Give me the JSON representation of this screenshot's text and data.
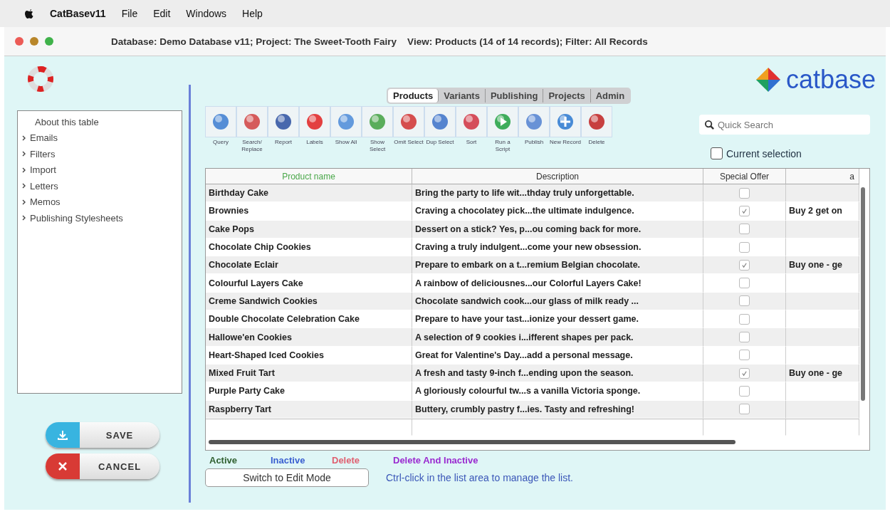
{
  "menu_bar": {
    "app_name": "CatBasev11",
    "items": [
      "File",
      "Edit",
      "Windows",
      "Help"
    ]
  },
  "window": {
    "title": "Database: Demo Database v11; Project: The Sweet-Tooth Fairy    View: Products (14 of 14 records); Filter: All Records"
  },
  "logo": {
    "text": "catbase"
  },
  "sidebar": {
    "items": [
      {
        "label": "About this table",
        "expandable": false
      },
      {
        "label": "Emails",
        "expandable": true
      },
      {
        "label": "Filters",
        "expandable": true
      },
      {
        "label": "Import",
        "expandable": true
      },
      {
        "label": "Letters",
        "expandable": true
      },
      {
        "label": "Memos",
        "expandable": true
      },
      {
        "label": "Publishing Stylesheets",
        "expandable": true
      }
    ]
  },
  "actions": [
    {
      "kind": "save",
      "label": "SAVE"
    },
    {
      "kind": "cancel",
      "label": "CANCEL"
    }
  ],
  "tabs": [
    {
      "label": "Products",
      "selected": true
    },
    {
      "label": "Variants",
      "selected": false
    },
    {
      "label": "Publishing",
      "selected": false
    },
    {
      "label": "Projects",
      "selected": false
    },
    {
      "label": "Admin",
      "selected": false
    }
  ],
  "toolbar": [
    {
      "kind": "query",
      "label": "Query"
    },
    {
      "kind": "search",
      "label": "Search/ Replace"
    },
    {
      "kind": "report",
      "label": "Report"
    },
    {
      "kind": "labels",
      "label": "Labels"
    },
    {
      "kind": "showall",
      "label": "Show All"
    },
    {
      "kind": "showselect",
      "label": "Show Select"
    },
    {
      "kind": "omit",
      "label": "Omit Select"
    },
    {
      "kind": "dup",
      "label": "Dup Select"
    },
    {
      "kind": "sort",
      "label": "Sort"
    },
    {
      "kind": "script",
      "label": "Run a Script"
    },
    {
      "kind": "publish",
      "label": "Publish"
    },
    {
      "kind": "new",
      "label": "New Record"
    },
    {
      "kind": "delete",
      "label": "Delete"
    }
  ],
  "quick_search": {
    "placeholder": "Quick Search"
  },
  "current_selection": {
    "label": "Current selection",
    "checked": false
  },
  "table": {
    "columns": [
      "Product name",
      "Description",
      "Special Offer",
      "a"
    ],
    "rows": [
      {
        "name": "Birthday Cake",
        "description": "Bring the party to life wit...thday truly unforgettable.",
        "special_offer": false
      },
      {
        "name": "Brownies",
        "description": "Craving a chocolatey pick...the ultimate indulgence.",
        "special_offer": true,
        "column_4": "Buy 2 get on"
      },
      {
        "name": "Cake Pops",
        "description": "Dessert on a stick? Yes, p...ou coming back for more.",
        "special_offer": false
      },
      {
        "name": "Chocolate Chip Cookies",
        "description": "Craving a truly indulgent...come your new obsession.",
        "special_offer": false
      },
      {
        "name": "Chocolate Eclair",
        "description": "Prepare to embark on a t...remium Belgian chocolate.",
        "special_offer": true,
        "column_4": "Buy one - ge"
      },
      {
        "name": "Colourful Layers Cake",
        "description": "A rainbow of deliciousnes...our Colorful Layers Cake!",
        "special_offer": false
      },
      {
        "name": "Creme Sandwich Cookies",
        "description": "Chocolate sandwich cook...our glass of milk ready ...",
        "special_offer": false
      },
      {
        "name": "Double Chocolate Celebration Cake",
        "description": "Prepare to have your tast...ionize your dessert game.",
        "special_offer": false
      },
      {
        "name": "Hallowe'en Cookies",
        "description": "A selection of 9 cookies i...ifferent shapes per pack.",
        "special_offer": false
      },
      {
        "name": "Heart-Shaped Iced Cookies",
        "description": "Great for Valentine's Day...add a personal message.",
        "special_offer": false
      },
      {
        "name": "Mixed Fruit Tart",
        "description": "A fresh and tasty 9-inch f...ending upon the season.",
        "special_offer": true,
        "column_4": "Buy one - ge"
      },
      {
        "name": "Purple Party Cake",
        "description": "A gloriously colourful tw...s a vanilla Victoria sponge.",
        "special_offer": false
      },
      {
        "name": "Raspberry Tart",
        "description": "Buttery, crumbly pastry f...ies. Tasty and refreshing!",
        "special_offer": false
      }
    ]
  },
  "legend": [
    {
      "label": "Active",
      "color": "#2f5f2f"
    },
    {
      "label": "Inactive",
      "color": "#3a5fd0"
    },
    {
      "label": "Delete",
      "color": "#e06070"
    },
    {
      "label": "Delete And Inactive",
      "color": "#9a2ad0"
    }
  ],
  "edit_mode_button": {
    "label": "Switch to Edit Mode"
  },
  "hint": "Ctrl-click in the list area to manage the list."
}
